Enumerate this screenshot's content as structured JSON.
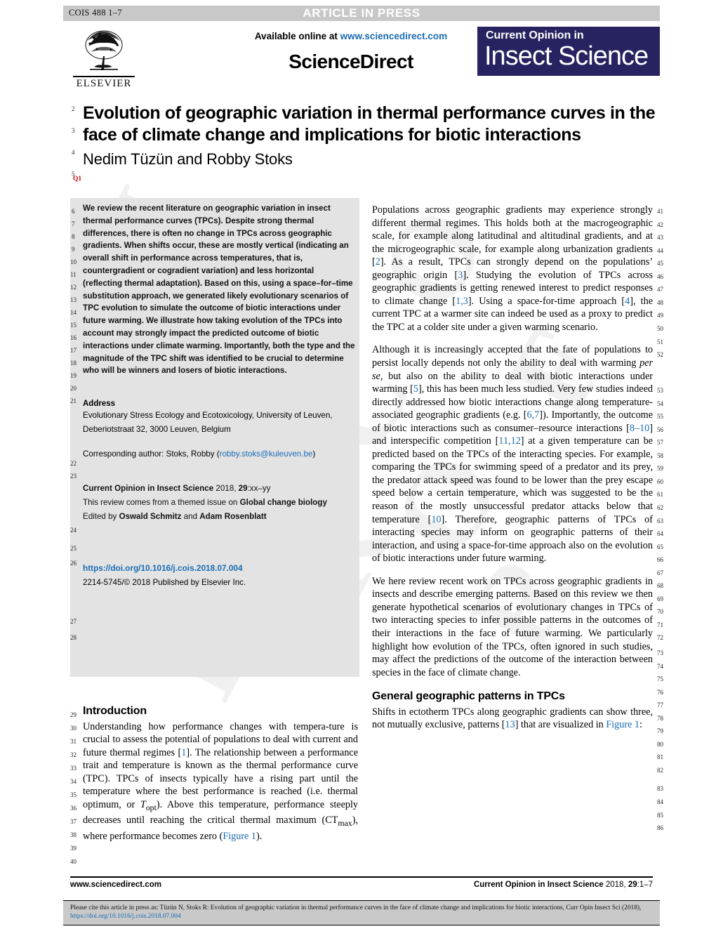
{
  "banner": {
    "code": "COIS 488 1–7",
    "status": "ARTICLE IN PRESS"
  },
  "masthead": {
    "publisher": "ELSEVIER",
    "available_text": "Available online at ",
    "available_link": "www.sciencedirect.com",
    "platform": "ScienceDirect",
    "journal_line1": "Current Opinion in",
    "journal_line2": "Insect Science",
    "journal_bg": "#262360"
  },
  "article": {
    "title": "Evolution of geographic variation in thermal performance curves in the face of climate change and implications for biotic interactions",
    "authors": "Nedim Tüzün and Robby Stoks",
    "query_marker": "Q1"
  },
  "abstract": {
    "text": "We review the recent literature on geographic variation in insect thermal performance curves (TPCs). Despite strong thermal differences, there is often no change in TPCs across geographic gradients. When shifts occur, these are mostly vertical (indicating an overall shift in performance across temperatures, that is, countergradient or cogradient variation) and less horizontal (reflecting thermal adaptation). Based on this, using a space–for–time substitution approach, we generated likely evolutionary scenarios of TPC evolution to simulate the outcome of biotic interactions under future warming. We illustrate how taking evolution of the TPCs into account may strongly impact the predicted outcome of biotic interactions under climate warming. Importantly, both the type and the magnitude of the TPC shift was identified to be crucial to determine who will be winners and losers of biotic interactions."
  },
  "address": {
    "heading": "Address",
    "line1": "Evolutionary Stress Ecology and Ecotoxicology, University of Leuven,",
    "line2": "Deberiotstraat 32, 3000 Leuven, Belgium",
    "corresponding_prefix": "Corresponding author: Stoks, Robby (",
    "corresponding_email": "robby.stoks@kuleuven.be",
    "corresponding_suffix": ")"
  },
  "journal_meta": {
    "citation_bold": "Current Opinion in Insect Science",
    "citation_rest": " 2018, ",
    "volume": "29",
    "pages": ":xx–yy",
    "issue_prefix": "This review comes from a themed issue on ",
    "issue_topic": "Global change biology",
    "edited_prefix": "Edited by ",
    "editor1": "Oswald Schmitz",
    "edited_mid": " and ",
    "editor2": "Adam Rosenblatt",
    "doi": "https://doi.org/10.1016/j.cois.2018.07.004",
    "issn": "2214-5745/© 2018 Published by Elsevier Inc."
  },
  "sections": {
    "introduction_heading": "Introduction",
    "general_heading": "General geographic patterns in TPCs"
  },
  "paragraphs": {
    "intro": [
      "Understanding how performance changes with tempera-",
      "ture is crucial to assess the potential of populations to deal",
      "with current and future thermal regimes [1]. The rela-",
      "tionship between a performance trait and temperature is",
      "known as the thermal performance curve (TPC). TPCs of",
      "insects typically have a rising part until the temperature",
      "where the best performance is reached (i.e. thermal",
      "optimum, or Topt). Above this temperature, performance",
      "steeply decreases until reaching the critical thermal max-",
      "imum (CTmax), where performance becomes zero",
      "(Figure 1)."
    ],
    "right_p1": "Populations across geographic gradients may experience strongly different thermal regimes. This holds both at the macrogeographic scale, for example along latitudinal and altitudinal gradients, and at the microgeographic scale, for example along urbanization gradients [2]. As a result, TPCs can strongly depend on the populations’ geographic origin [3]. Studying the evolution of TPCs across geographic gradients is getting renewed interest to predict responses to climate change [1,3]. Using a space-for-time approach [4], the current TPC at a warmer site can indeed be used as a proxy to predict the TPC at a colder site under a given warming scenario.",
    "right_p2": "Although it is increasingly accepted that the fate of populations to persist locally depends not only the ability to deal with warming per se, but also on the ability to deal with biotic interactions under warming [5], this has been much less studied. Very few studies indeed directly addressed how biotic interactions change along temperature-associated geographic gradients (e.g. [6,7]). Importantly, the outcome of biotic interactions such as consumer–resource interactions [8–10] and interspecific competition [11,12] at a given temperature can be predicted based on the TPCs of the interacting species. For example, comparing the TPCs for swimming speed of a predator and its prey, the predator attack speed was found to be lower than the prey escape speed below a certain temperature, which was suggested to be the reason of the mostly unsuccessful predator attacks below that temperature [10]. Therefore, geographic patterns of TPCs of interacting species may inform on geographic patterns of their interaction, and using a space-for-time approach also on the evolution of biotic interactions under future warming.",
    "right_p3": "We here review recent work on TPCs across geographic gradients in insects and describe emerging patterns. Based on this review we then generate hypothetical scenarios of evolutionary changes in TPCs of two interacting species to infer possible patterns in the outcomes of their interactions in the face of future warming. We particularly highlight how evolution of the TPCs, often ignored in such studies, may affect the predictions of the outcome of the interaction between species in the face of climate change.",
    "right_p4": "Shifts in ectotherm TPCs along geographic gradients can show three, not mutually exclusive, patterns [13] that are visualized in Figure 1:"
  },
  "footer": {
    "left": "www.sciencedirect.com",
    "right_bold": "Current Opinion in Insect Science",
    "right_rest": " 2018, ",
    "right_vol": "29",
    "right_pages": ":1–7",
    "cite_text": "Please cite this article in press as: Tüzün N, Stoks R: Evolution of geographic variation in thermal performance curves in the face of climate change and implications for biotic interactions, Curr Opin Insect Sci (2018), ",
    "cite_link": "https://doi.org/10.1016/j.cois.2018.07.004"
  },
  "watermark": "UNCORRECTED PROOF",
  "line_numbers": {
    "title": [
      "2",
      "3",
      "4",
      "5"
    ],
    "abstract": [
      "6",
      "7",
      "8",
      "9",
      "10",
      "11",
      "12",
      "13",
      "14",
      "15",
      "16",
      "17",
      "18",
      "19",
      "20",
      "21"
    ],
    "address": [
      "22",
      "23"
    ],
    "meta": [
      "24",
      "25",
      "26"
    ],
    "doi": [
      "27",
      "28"
    ],
    "intro": [
      "29",
      "30",
      "31",
      "32",
      "33",
      "34",
      "35",
      "36",
      "37",
      "38",
      "39",
      "40"
    ],
    "right": [
      "41",
      "42",
      "43",
      "44",
      "45",
      "46",
      "47",
      "48",
      "49",
      "50",
      "51",
      "52",
      "53",
      "54",
      "55",
      "56",
      "57",
      "58",
      "59",
      "60",
      "61",
      "62",
      "63",
      "64",
      "65",
      "66",
      "67",
      "68",
      "69",
      "70",
      "71",
      "72",
      "73",
      "74",
      "75",
      "76",
      "77",
      "78",
      "79",
      "80",
      "81",
      "82",
      "83",
      "84",
      "85",
      "86"
    ]
  }
}
